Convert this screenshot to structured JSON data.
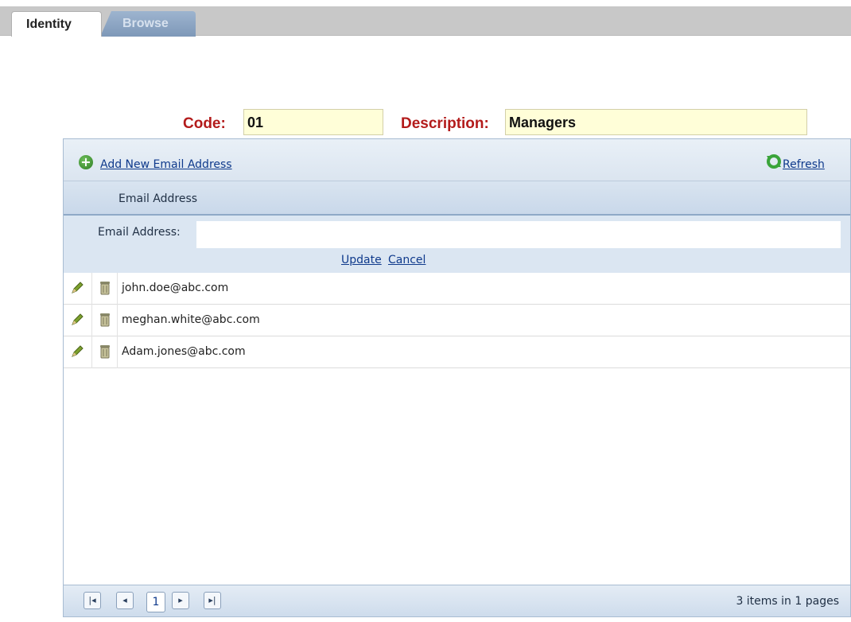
{
  "tabs": [
    {
      "label": "Identity",
      "active": true
    },
    {
      "label": "Browse",
      "active": false
    }
  ],
  "form": {
    "code_label": "Code:",
    "code_value": "01",
    "description_label": "Description:",
    "description_value": "Managers"
  },
  "grid": {
    "add_link": "Add New Email Address",
    "refresh_link": "Refresh",
    "column_header": "Email Address",
    "edit_form": {
      "field_label": "Email Address:",
      "field_value": "",
      "update_link": "Update",
      "cancel_link": "Cancel"
    },
    "rows": [
      {
        "email": "john.doe@abc.com"
      },
      {
        "email": "meghan.white@abc.com"
      },
      {
        "email": "Adam.jones@abc.com"
      }
    ],
    "pager": {
      "current_page": "1",
      "summary": "3 items in 1 pages"
    }
  },
  "colors": {
    "label_red": "#b31b1b",
    "field_yellow": "#fffed8",
    "link_blue": "#0f3a8c",
    "grid_blue": "#dbe6f2"
  }
}
